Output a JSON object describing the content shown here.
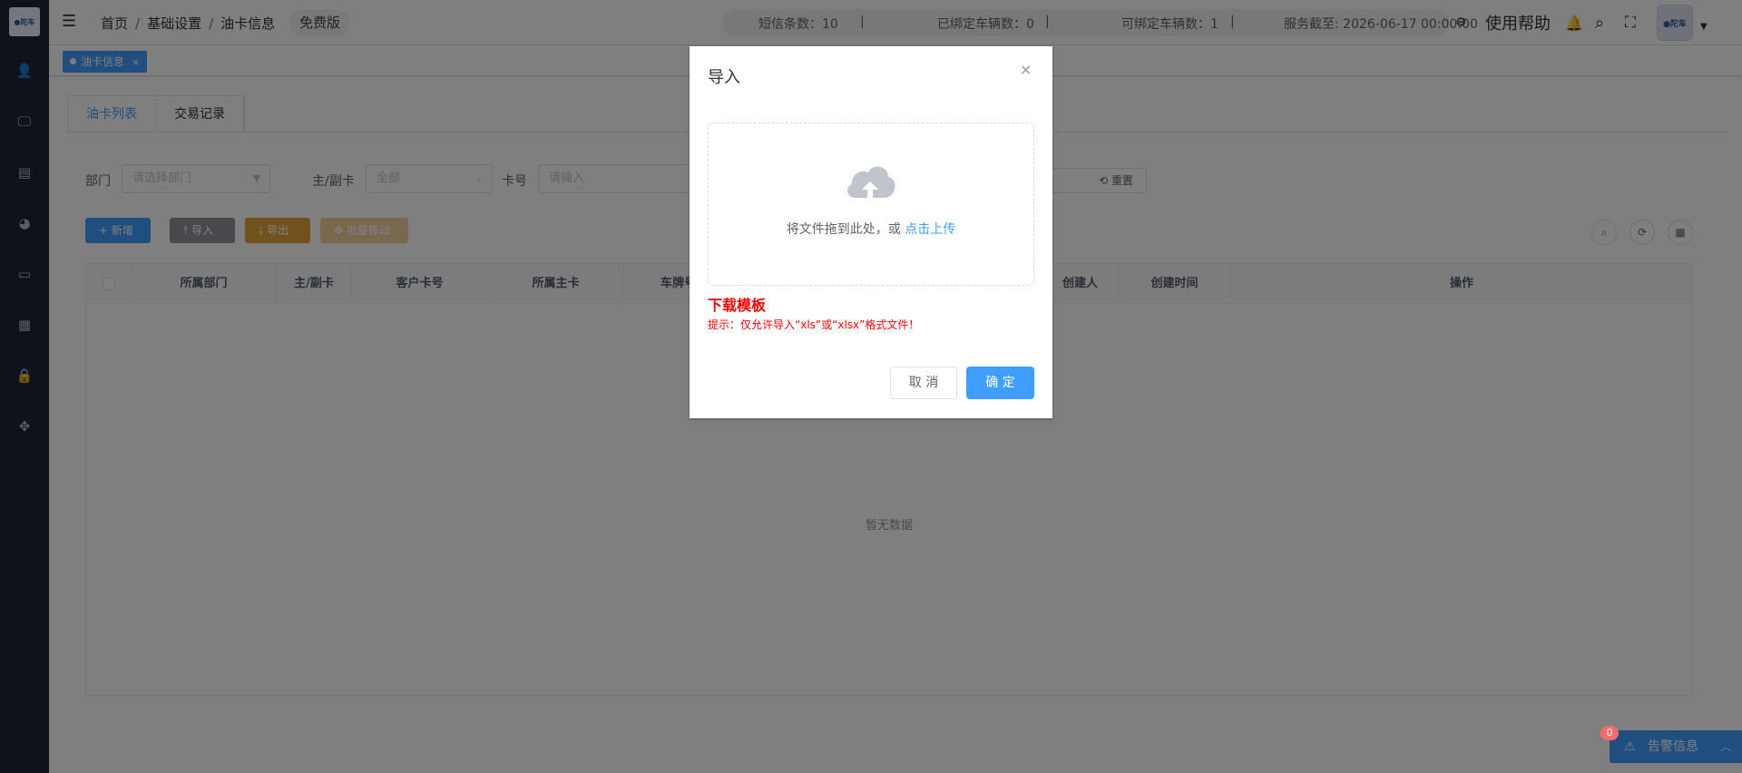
{
  "logo": {
    "text": "●陀车"
  },
  "header": {
    "breadcrumb": [
      "首页",
      "基础设置",
      "油卡信息"
    ],
    "sep": "/",
    "plan": "免费版",
    "stats": {
      "sms": "短信条数：10",
      "bound": "已绑定车辆数：0",
      "available": "可绑定车辆数：1",
      "expiry": "服务截至: 2026-06-17 00:00:00",
      "divider": "|"
    },
    "help": "使用帮助"
  },
  "tags": [
    {
      "label": "油卡信息",
      "close": "×"
    }
  ],
  "tabs": [
    {
      "label": "油卡列表",
      "active": true
    },
    {
      "label": "交易记录",
      "active": false
    }
  ],
  "filters": {
    "dept_label": "部门",
    "dept_placeholder": "请选择部门",
    "type_label": "主/副卡",
    "type_value": "全部",
    "card_label": "卡号",
    "card_placeholder": "请输入",
    "reset": "重置"
  },
  "toolbar": {
    "add": "+ 新增",
    "import": "导入",
    "export": "导出",
    "batch": "批量移动"
  },
  "table": {
    "columns": [
      "所属部门",
      "主/副卡",
      "客户卡号",
      "所属主卡",
      "车牌号",
      "创建人",
      "创建时间",
      "操作"
    ],
    "empty": "暂无数据"
  },
  "alert": {
    "label": "告警信息",
    "count": "0"
  },
  "dialog": {
    "title": "导入",
    "close": "×",
    "drop_text": "将文件拖到此处，或",
    "upload_link": "点击上传",
    "download_template": "下载模板",
    "hint": "提示：仅允许导入“xls”或“xlsx”格式文件！",
    "cancel": "取 消",
    "confirm": "确 定"
  },
  "colors": {
    "primary": "#409eff",
    "danger": "#ff0000",
    "sidebar": "#1f2430"
  }
}
